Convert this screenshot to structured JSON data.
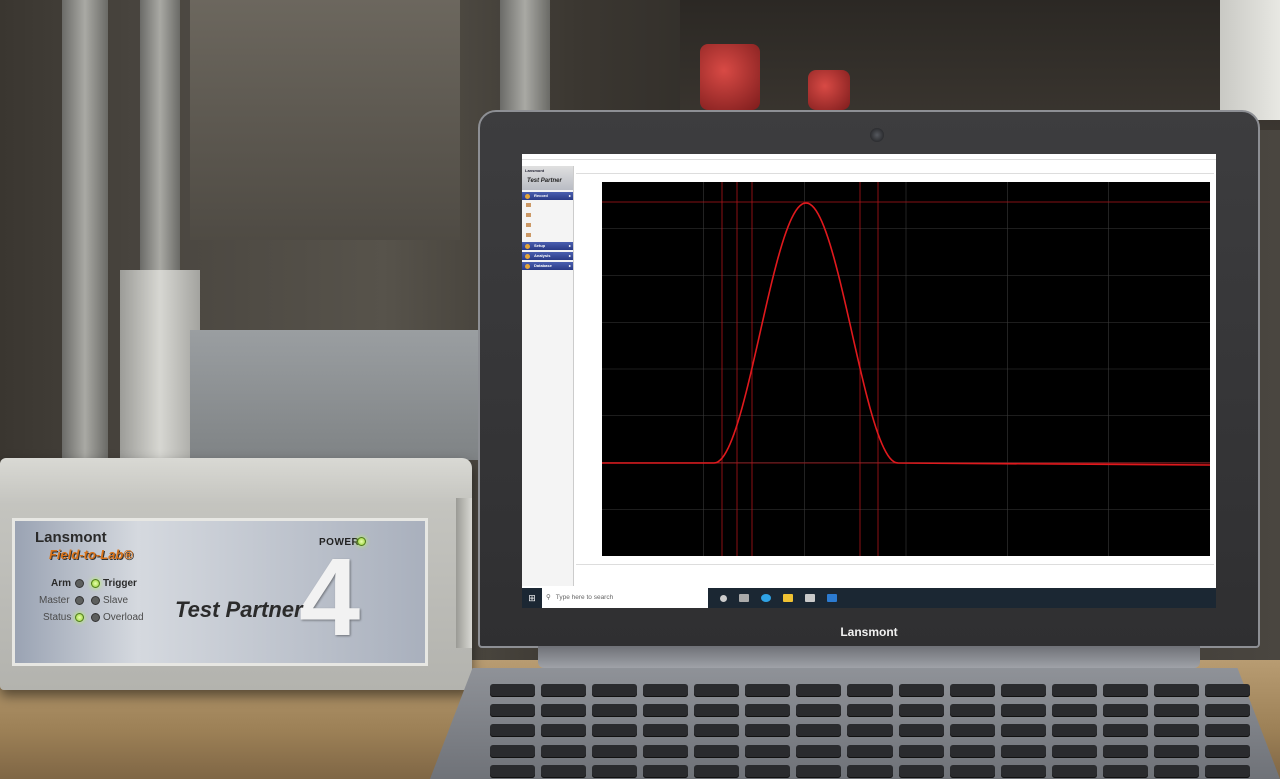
{
  "test_partner": {
    "brand": "Lansmont",
    "sub_brand": "Field-to-Lab®",
    "power_label": "POWER",
    "title": "Test Partner",
    "model_number": "4",
    "indicators": {
      "arm": "Arm",
      "trigger": "Trigger",
      "master": "Master",
      "slave": "Slave",
      "status": "Status",
      "overload": "Overload"
    }
  },
  "laptop": {
    "brand": "Lansmont"
  },
  "app": {
    "sidebar": {
      "brand": "Lansmont",
      "name": "Test Partner",
      "record": "Record",
      "setup": "Setup",
      "analysis": "Analysis",
      "database": "Database"
    }
  },
  "taskbar": {
    "search_placeholder": "Type here to search"
  },
  "colors": {
    "trace": "#e0191d",
    "plot_bg": "#000000",
    "led_on": "#9fdc3a",
    "sidebar_header": "#2a3a86"
  }
}
